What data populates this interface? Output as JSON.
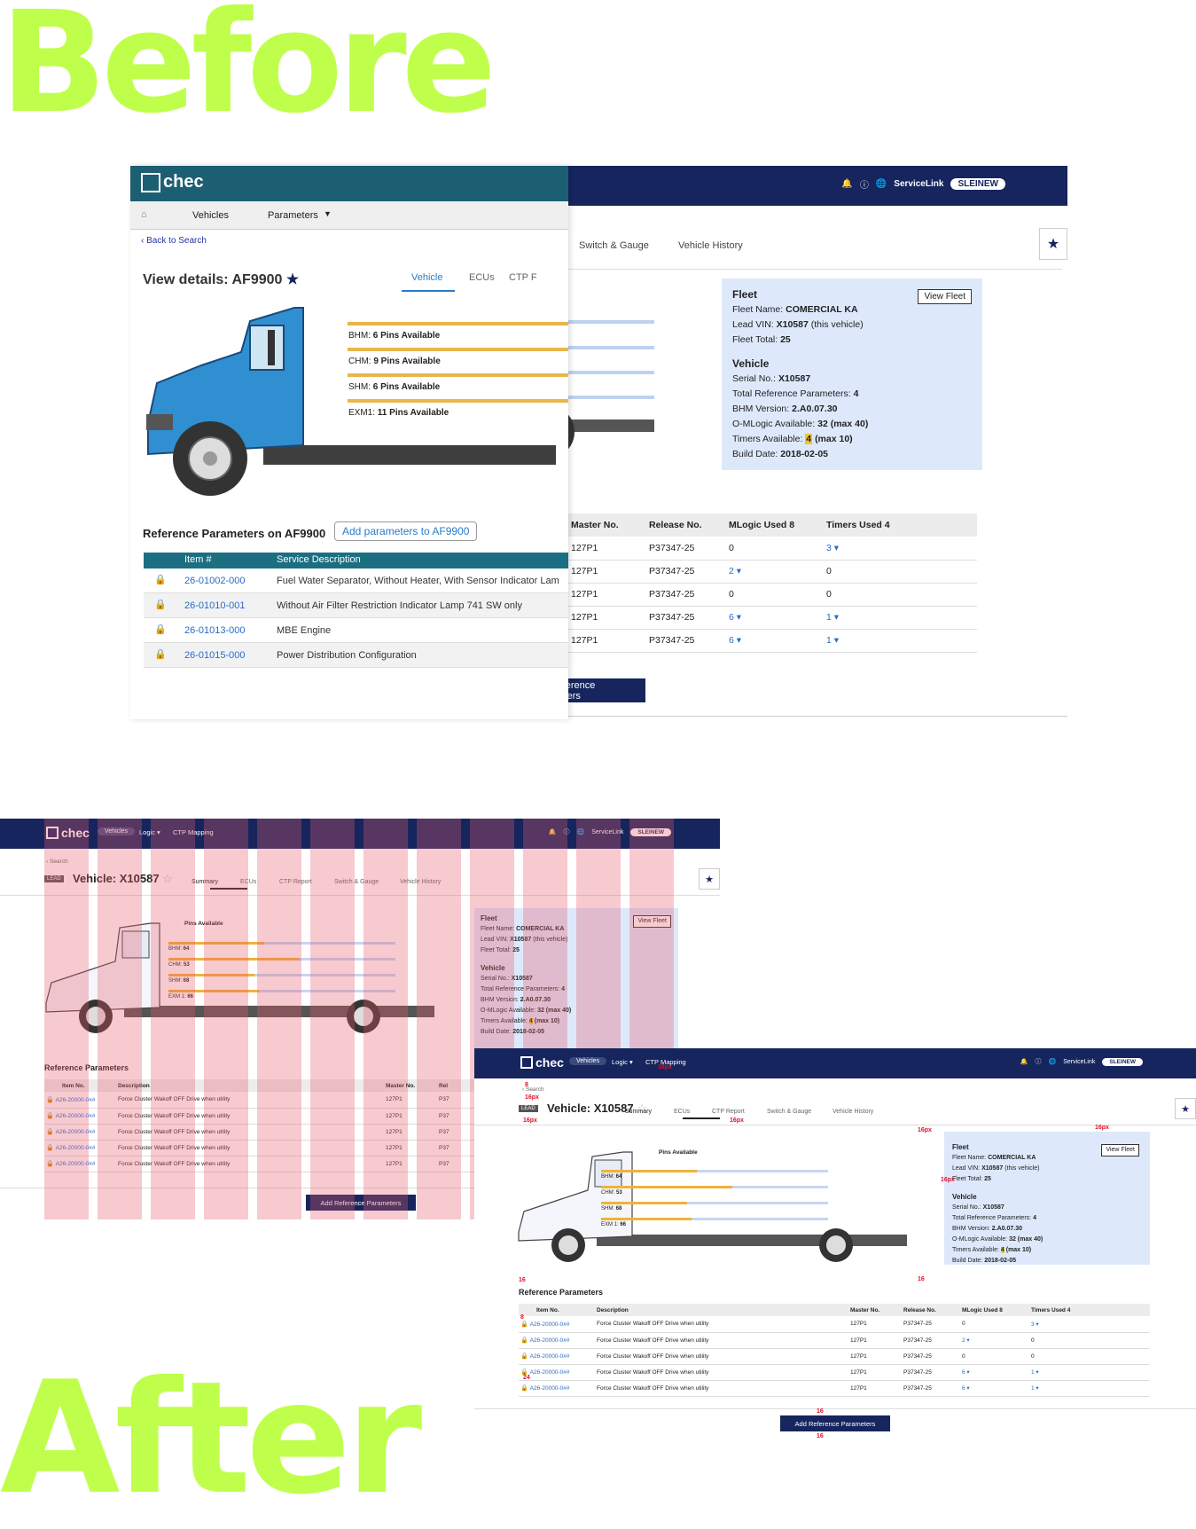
{
  "headline_before": "Before",
  "headline_after": "After",
  "brand": "chec",
  "nav": {
    "vehicles": "Vehicles",
    "logic": "Logic",
    "ctp": "CTP Mapping",
    "servicelink": "ServiceLink",
    "user": "SLEINEW"
  },
  "legacy": {
    "crumb_vehicles": "Vehicles",
    "crumb_parameters": "Parameters",
    "back": "Back to Search",
    "title": "View details: AF9900",
    "tabs": [
      "Vehicle",
      "ECUs",
      "CTP F"
    ],
    "pins": [
      {
        "label": "BHM:",
        "value": "6 Pins Available"
      },
      {
        "label": "CHM:",
        "value": "9 Pins Available"
      },
      {
        "label": "SHM:",
        "value": "6 Pins Available"
      },
      {
        "label": "EXM1:",
        "value": "11 Pins Available"
      }
    ],
    "ref_title": "Reference Parameters on AF9900",
    "ref_button": "Add parameters to AF9900",
    "col_item": "Item #",
    "col_desc": "Service Description",
    "rows": [
      {
        "item": "26-01002-000",
        "desc": "Fuel Water Separator, Without Heater, With Sensor Indicator Lam"
      },
      {
        "item": "26-01010-001",
        "desc": "Without Air Filter Restriction Indicator Lamp 741 SW only"
      },
      {
        "item": "26-01013-000",
        "desc": "MBE Engine"
      },
      {
        "item": "26-01015-000",
        "desc": "Power Distribution Configuration"
      }
    ],
    "ghost_title": "Vehicle: X10587"
  },
  "vehicle": {
    "search": "Search",
    "lead": "LEAD",
    "title": "Vehicle: X10587",
    "tabs": [
      "Summary",
      "ECUs",
      "CTP Report",
      "Switch & Gauge",
      "Vehicle History"
    ],
    "pins_title": "Pins Available",
    "pins": [
      {
        "label": "BHM:",
        "value": "64",
        "fill": 0.42
      },
      {
        "label": "CHM:",
        "value": "53",
        "fill": 0.58
      },
      {
        "label": "SHM:",
        "value": "68",
        "fill": 0.38
      },
      {
        "label": "EXM 1:",
        "value": "66",
        "fill": 0.4
      }
    ],
    "fleet": {
      "heading": "Fleet",
      "view_button": "View Fleet",
      "name_label": "Fleet Name:",
      "name": "COMERCIAL KA",
      "lead_label": "Lead VIN:",
      "lead": "X10587",
      "lead_note": "(this vehicle)",
      "total_label": "Fleet Total:",
      "total": "25"
    },
    "veh": {
      "heading": "Vehicle",
      "serial_label": "Serial No.:",
      "serial": "X10587",
      "trp_label": "Total Reference Parameters:",
      "trp": "4",
      "bhm_label": "BHM Version:",
      "bhm": "2.A0.07.30",
      "omlogic_label": "O-MLogic Available:",
      "omlogic": "32 (max 40)",
      "timers_label": "Timers Available:",
      "timers": "4",
      "timers_max": "(max 10)",
      "build_label": "Build Date:",
      "build": "2018-02-05"
    },
    "ref_heading": "Reference Parameters",
    "cols": [
      "Item No.",
      "Description",
      "Master No.",
      "Release No.",
      "MLogic Used 8",
      "Timers Used 4"
    ],
    "rows": [
      {
        "item": "A26-20000-0##",
        "desc": "Force Cluster Wakoff OFF Drive when utility",
        "master": "127P1",
        "release": "P37347-25",
        "mlogic": "0",
        "timers": "3"
      },
      {
        "item": "A26-20000-0##",
        "desc": "Force Cluster Wakoff OFF Drive when utility",
        "master": "127P1",
        "release": "P37347-25",
        "mlogic": "2",
        "timers": "0"
      },
      {
        "item": "A26-20000-0##",
        "desc": "Force Cluster Wakoff OFF Drive when utility",
        "master": "127P1",
        "release": "P37347-25",
        "mlogic": "0",
        "timers": "0"
      },
      {
        "item": "A26-20000-0##",
        "desc": "Force Cluster Wakoff OFF Drive when utility",
        "master": "127P1",
        "release": "P37347-25",
        "mlogic": "6",
        "timers": "1"
      },
      {
        "item": "A26-20000-0##",
        "desc": "Force Cluster Wakoff OFF Drive when utility",
        "master": "127P1",
        "release": "P37347-25",
        "mlogic": "6",
        "timers": "1"
      }
    ],
    "add_button": "Add Reference Parameters"
  },
  "spec": [
    "16px",
    "8",
    "24",
    "16"
  ],
  "colors": {
    "navy": "#16255d",
    "accent_green": "#bfff4b",
    "fleet_bg": "#dde9fb",
    "bar_orange": "#f0b13c"
  }
}
